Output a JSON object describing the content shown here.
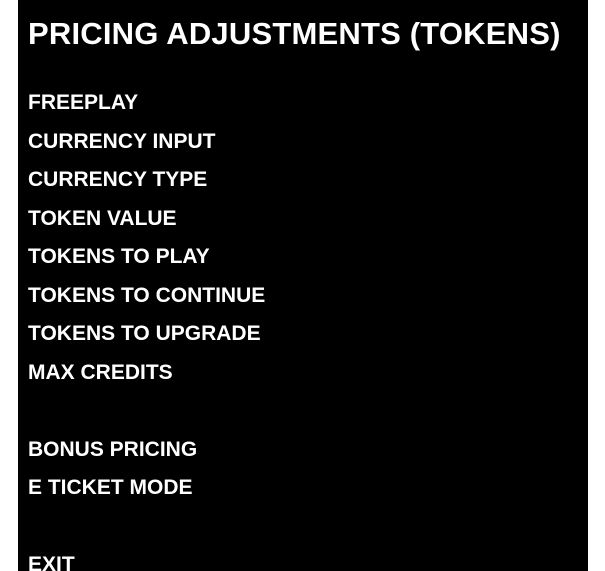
{
  "screen": {
    "title": "PRICING ADJUSTMENTS (TOKENS)"
  },
  "menu": {
    "group1": [
      "FREEPLAY",
      "CURRENCY INPUT",
      "CURRENCY TYPE",
      "TOKEN VALUE",
      "TOKENS TO PLAY",
      "TOKENS TO CONTINUE",
      "TOKENS TO UPGRADE",
      "MAX CREDITS"
    ],
    "group2": [
      "BONUS PRICING",
      "E TICKET MODE"
    ],
    "group3": [
      "EXIT"
    ]
  },
  "colors": {
    "background": "#000000",
    "text": "#ffffff",
    "border": "#ffffff"
  }
}
